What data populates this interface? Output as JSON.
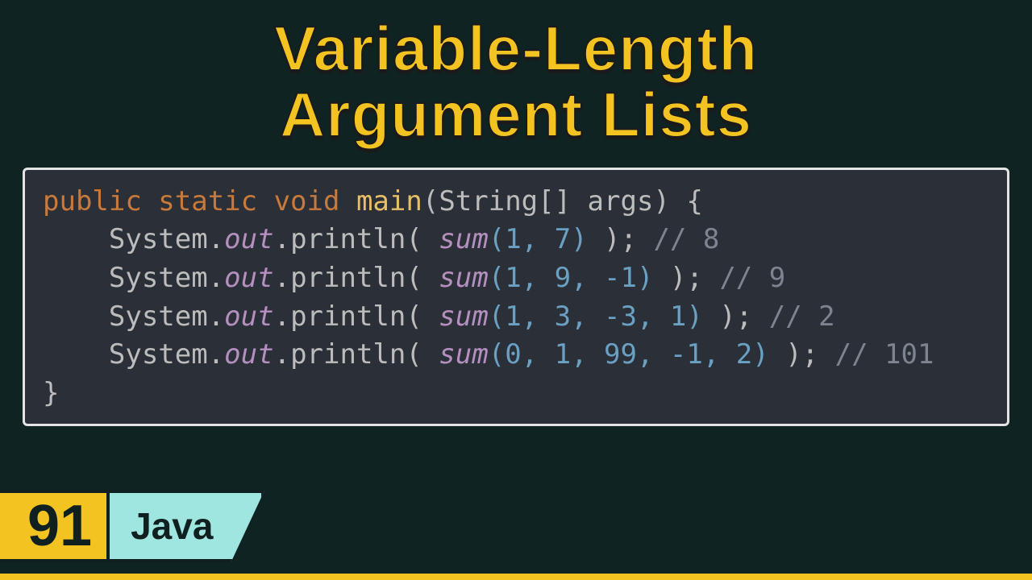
{
  "title_line1": "Variable-Length",
  "title_line2": "Argument Lists",
  "code": {
    "sig": {
      "kw": "public static void",
      "name": "main",
      "params": "(String[] args) {"
    },
    "lines": [
      {
        "pre": "    System.",
        "out": "out",
        "mid1": ".println( ",
        "fn": "sum",
        "args": "(1, 7)",
        "mid2": " ); ",
        "cmt": "// 8"
      },
      {
        "pre": "    System.",
        "out": "out",
        "mid1": ".println( ",
        "fn": "sum",
        "args": "(1, 9, -1)",
        "mid2": " ); ",
        "cmt": "// 9"
      },
      {
        "pre": "    System.",
        "out": "out",
        "mid1": ".println( ",
        "fn": "sum",
        "args": "(1, 3, -3, 1)",
        "mid2": " ); ",
        "cmt": "// 2"
      },
      {
        "pre": "    System.",
        "out": "out",
        "mid1": ".println( ",
        "fn": "sum",
        "args": "(0, 1, 99, -1, 2)",
        "mid2": " ); ",
        "cmt": "// 101"
      }
    ],
    "close": "}"
  },
  "footer": {
    "number": "91",
    "language": "Java"
  }
}
